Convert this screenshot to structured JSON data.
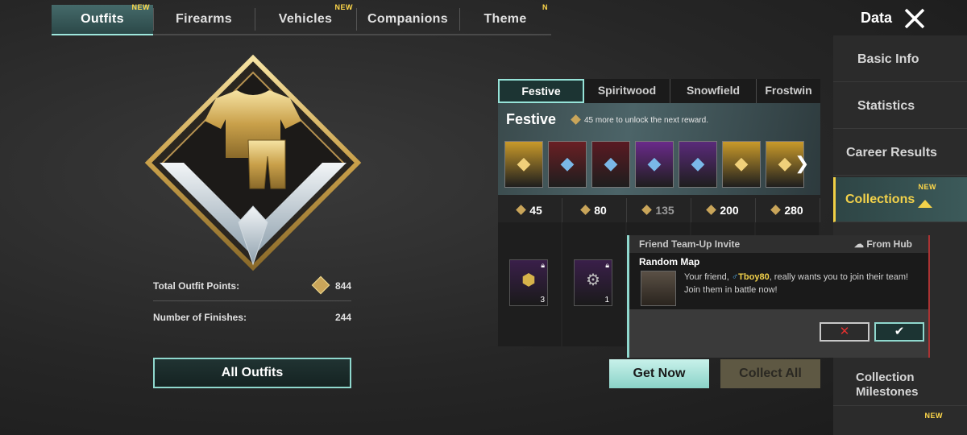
{
  "top_tabs": [
    {
      "label": "Outfits",
      "badge": "NEW",
      "active": true
    },
    {
      "label": "Firearms",
      "badge": "",
      "active": false
    },
    {
      "label": "Vehicles",
      "badge": "NEW",
      "active": false
    },
    {
      "label": "Companions",
      "badge": "",
      "active": false
    },
    {
      "label": "Theme",
      "badge": "N",
      "active": false
    }
  ],
  "header": {
    "title": "Data"
  },
  "sidebar": {
    "items": [
      {
        "label": "Basic Info",
        "badge": ""
      },
      {
        "label": "Statistics",
        "badge": ""
      },
      {
        "label": "Career Results",
        "badge": ""
      },
      {
        "label": "Collections",
        "badge": "NEW",
        "active": true
      },
      {
        "label": "Collection Milestones",
        "badge": ""
      },
      {
        "label": "",
        "badge": "NEW"
      }
    ]
  },
  "stats": {
    "total_points_label": "Total Outfit Points:",
    "total_points_value": "844",
    "finishes_label": "Number of Finishes:",
    "finishes_value": "244"
  },
  "all_outfits_label": "All Outfits",
  "collection": {
    "tabs": [
      "Festive",
      "Spiritwood",
      "Snowfield",
      "Frostwin"
    ],
    "active_tab": 0,
    "name": "Festive",
    "hint": "45 more to unlock the next reward.",
    "rewards": [
      {
        "icon": "golden-outfit-icon",
        "color": "#c99a2a"
      },
      {
        "icon": "crimson-bow-icon",
        "color": "#6a1f24"
      },
      {
        "icon": "blue-charm-icon",
        "color": "#5a1a22"
      },
      {
        "icon": "blue-orb-icon",
        "color": "#6a2a8a"
      },
      {
        "icon": "blue-potion-icon",
        "color": "#5a2a7a"
      },
      {
        "icon": "golden-outfit-icon",
        "color": "#c99a2a"
      },
      {
        "icon": "golden-outfit-icon",
        "color": "#c99a2a"
      }
    ],
    "milestones": [
      {
        "value": "45",
        "dim": false
      },
      {
        "value": "80",
        "dim": false
      },
      {
        "value": "135",
        "dim": true
      },
      {
        "value": "200",
        "dim": false
      },
      {
        "value": "280",
        "dim": false
      }
    ],
    "items": [
      {
        "qty": "3",
        "icon": "gold-nugget-icon",
        "color": "#3a1f4a"
      },
      {
        "qty": "1",
        "icon": "dispenser-icon",
        "color": "#3a1f4a"
      }
    ]
  },
  "buttons": {
    "get_now": "Get Now",
    "collect_all": "Collect All"
  },
  "invite": {
    "title": "Friend Team-Up Invite",
    "source": "From Hub",
    "mode": "Random Map",
    "message_prefix": "Your friend,",
    "friend_name": "Tboy80",
    "message_suffix": ", really wants you to join their team! Join them in battle now!"
  },
  "colors": {
    "accent_teal": "#8fd8ce",
    "accent_gold": "#f3d24a",
    "decline_red": "#e0302f"
  }
}
